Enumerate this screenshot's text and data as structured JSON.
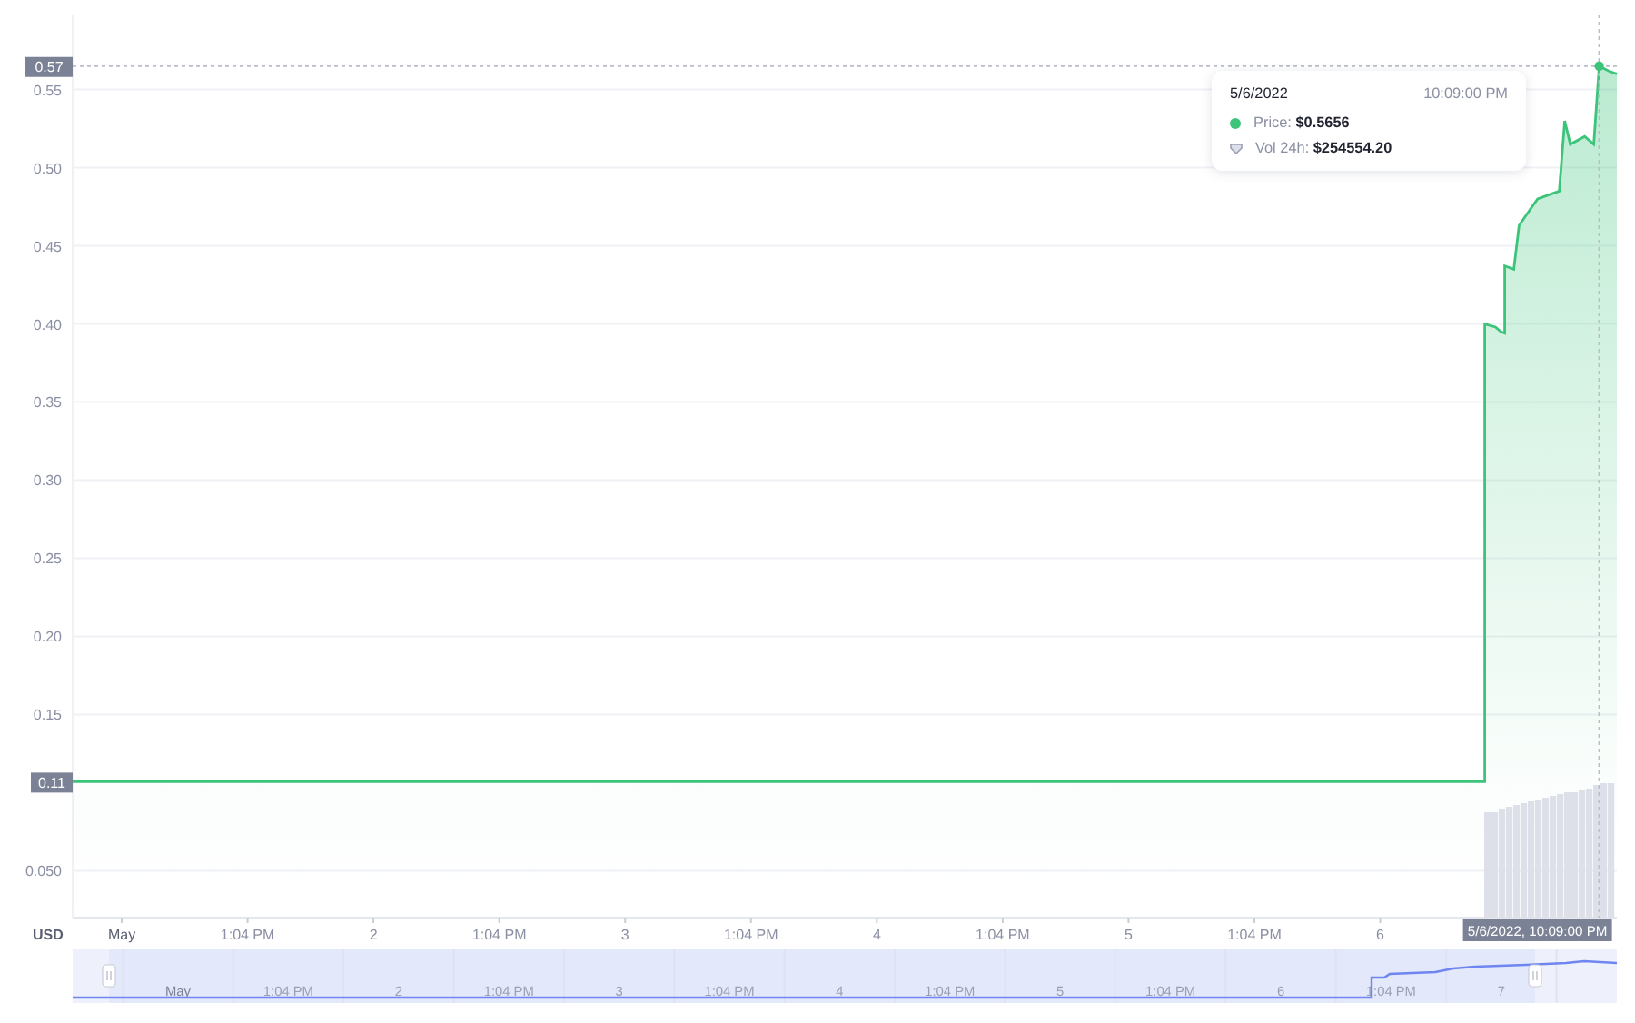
{
  "chart": {
    "chart_data": {
      "type": "area",
      "grid": true,
      "ylabel": "USD",
      "xlim": [
        0.805,
        6.94
      ],
      "ylim": [
        0.02,
        0.598
      ],
      "yticks": [
        {
          "value": 0.05,
          "label": "0.050"
        },
        {
          "value": 0.15,
          "label": "0.15"
        },
        {
          "value": 0.2,
          "label": "0.20"
        },
        {
          "value": 0.25,
          "label": "0.25"
        },
        {
          "value": 0.3,
          "label": "0.30"
        },
        {
          "value": 0.35,
          "label": "0.35"
        },
        {
          "value": 0.4,
          "label": "0.40"
        },
        {
          "value": 0.45,
          "label": "0.45"
        },
        {
          "value": 0.5,
          "label": "0.50"
        },
        {
          "value": 0.55,
          "label": "0.55"
        }
      ],
      "xticks": [
        {
          "value": 1,
          "label": "May"
        },
        {
          "value": 2,
          "label": "2"
        },
        {
          "value": 3,
          "label": "3"
        },
        {
          "value": 4,
          "label": "4"
        },
        {
          "value": 5,
          "label": "5"
        },
        {
          "value": 6,
          "label": "6"
        }
      ],
      "x": [
        0.805,
        6.415,
        6.415,
        6.458,
        6.48,
        6.495,
        6.495,
        6.531,
        6.552,
        6.581,
        6.625,
        6.711,
        6.733,
        6.755,
        6.812,
        6.848,
        6.87,
        6.906,
        6.94
      ],
      "series": [
        {
          "color": "#3cc47a",
          "values": [
            0.107,
            0.107,
            0.4,
            0.398,
            0.395,
            0.394,
            0.437,
            0.435,
            0.463,
            0.47,
            0.48,
            0.485,
            0.53,
            0.515,
            0.52,
            0.515,
            0.565,
            0.562,
            0.56
          ]
        }
      ]
    },
    "midday_labels": [
      "1:04 PM",
      "1:04 PM",
      "1:04 PM",
      "1:04 PM",
      "1:04 PM"
    ],
    "price_badge": "0.57",
    "line_badge": "0.11",
    "time_badge": "5/6/2022, 10:09:00 PM"
  },
  "tooltip": {
    "date": "5/6/2022",
    "time": "10:09:00 PM",
    "rows": [
      {
        "kind": "price",
        "text": "Price: **$0.5656**"
      },
      {
        "kind": "volume",
        "text": "Vol 24h: **$254554.20**"
      }
    ]
  },
  "navigator": {
    "labels": [
      "May",
      "1:04 PM",
      "2",
      "1:04 PM",
      "3",
      "1:04 PM",
      "4",
      "1:04 PM",
      "5",
      "1:04 PM",
      "6",
      "1:04 PM",
      "7"
    ]
  }
}
